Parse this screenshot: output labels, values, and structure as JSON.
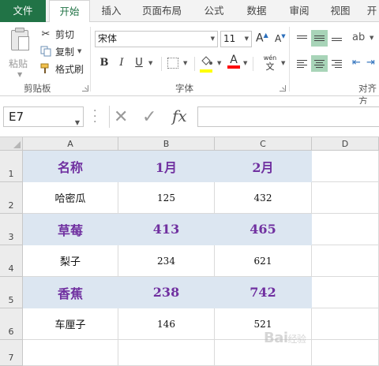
{
  "tabs": [
    "文件",
    "开始",
    "插入",
    "页面布局",
    "公式",
    "数据",
    "审阅",
    "视图",
    "开"
  ],
  "ribbon": {
    "clipboard": {
      "paste_label": "粘贴",
      "cut_label": "剪切",
      "copy_label": "复制",
      "format_painter_label": "格式刷",
      "group_label": "剪贴板"
    },
    "font": {
      "font_name": "宋体",
      "font_size": "11",
      "bold": "B",
      "italic": "I",
      "underline": "U",
      "font_color_letter": "A",
      "phonetic_label": "wén",
      "phonetic_char": "文",
      "group_label": "字体"
    },
    "alignment": {
      "group_label": "对齐方"
    }
  },
  "formula_bar": {
    "name_box": "E7",
    "fx_label": "fx",
    "formula": ""
  },
  "sheet": {
    "columns": [
      "A",
      "B",
      "C",
      "D"
    ],
    "rows": [
      "1",
      "2",
      "3",
      "4",
      "5",
      "6",
      "7"
    ],
    "cells": [
      [
        "名称",
        "1月",
        "2月"
      ],
      [
        "哈密瓜",
        "125",
        "432"
      ],
      [
        "草莓",
        "413",
        "465"
      ],
      [
        "梨子",
        "234",
        "621"
      ],
      [
        "香蕉",
        "238",
        "742"
      ],
      [
        "车厘子",
        "146",
        "521"
      ]
    ]
  },
  "watermark": {
    "text": "Bai",
    "suffix": "经验"
  },
  "colors": {
    "file_tab": "#217346",
    "header_fill": "#dce6f1",
    "header_text": "#7030a0",
    "selected_align": "#a8d4b8"
  }
}
